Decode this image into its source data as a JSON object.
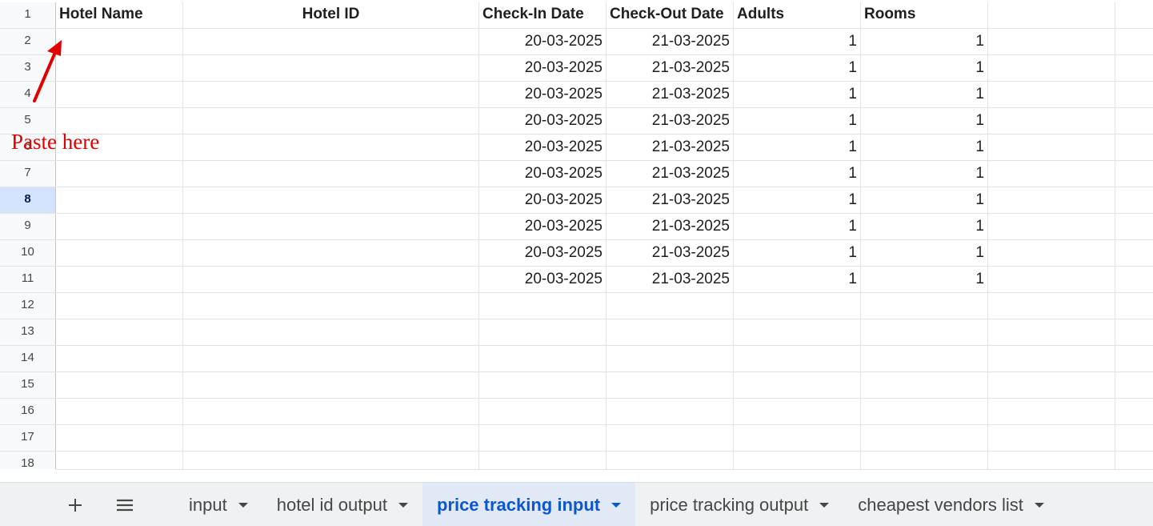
{
  "grid": {
    "header_row_number": "1",
    "headers": {
      "a": "Hotel Name",
      "b": "Hotel ID",
      "c": "Check-In Date",
      "d": "Check-Out Date",
      "e": "Adults",
      "f": "Rooms",
      "g": ""
    },
    "rows": [
      {
        "num": "2",
        "checkin": "20-03-2025",
        "checkout": "21-03-2025",
        "adults": "1",
        "rooms": "1"
      },
      {
        "num": "3",
        "checkin": "20-03-2025",
        "checkout": "21-03-2025",
        "adults": "1",
        "rooms": "1"
      },
      {
        "num": "4",
        "checkin": "20-03-2025",
        "checkout": "21-03-2025",
        "adults": "1",
        "rooms": "1"
      },
      {
        "num": "5",
        "checkin": "20-03-2025",
        "checkout": "21-03-2025",
        "adults": "1",
        "rooms": "1"
      },
      {
        "num": "6",
        "checkin": "20-03-2025",
        "checkout": "21-03-2025",
        "adults": "1",
        "rooms": "1"
      },
      {
        "num": "7",
        "checkin": "20-03-2025",
        "checkout": "21-03-2025",
        "adults": "1",
        "rooms": "1"
      },
      {
        "num": "8",
        "checkin": "20-03-2025",
        "checkout": "21-03-2025",
        "adults": "1",
        "rooms": "1"
      },
      {
        "num": "9",
        "checkin": "20-03-2025",
        "checkout": "21-03-2025",
        "adults": "1",
        "rooms": "1"
      },
      {
        "num": "10",
        "checkin": "20-03-2025",
        "checkout": "21-03-2025",
        "adults": "1",
        "rooms": "1"
      },
      {
        "num": "11",
        "checkin": "20-03-2025",
        "checkout": "21-03-2025",
        "adults": "1",
        "rooms": "1"
      }
    ],
    "empty_rows": [
      "12",
      "13",
      "14",
      "15",
      "16",
      "17",
      "18"
    ],
    "selected_row": "8"
  },
  "annotation": {
    "text": "Paste here",
    "color": "#e00000"
  },
  "sheet_tabs": {
    "add_icon": "plus-icon",
    "all_sheets_icon": "menu-icon",
    "tabs": [
      {
        "label": "input",
        "active": false
      },
      {
        "label": "hotel id output",
        "active": false
      },
      {
        "label": "price tracking input",
        "active": true
      },
      {
        "label": "price tracking output",
        "active": false
      },
      {
        "label": "cheapest vendors list",
        "active": false
      }
    ],
    "active_color": "#0b57d0"
  }
}
